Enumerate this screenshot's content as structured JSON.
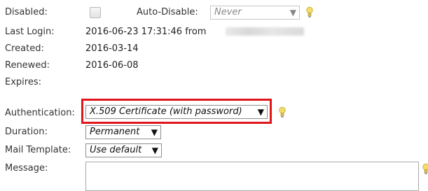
{
  "fields": {
    "disabled_label": "Disabled:",
    "auto_disable_label": "Auto-Disable:",
    "auto_disable_value": "Never",
    "last_login_label": "Last Login:",
    "last_login_value": "2016-06-23 17:31:46 from",
    "last_login_ip_hidden": "201.2016-06-08",
    "created_label": "Created:",
    "created_value": "2016-03-14",
    "renewed_label": "Renewed:",
    "renewed_value": "2016-06-08",
    "expires_label": "Expires:",
    "authentication_label": "Authentication:",
    "authentication_value": "X.509 Certificate (with password)",
    "duration_label": "Duration:",
    "duration_value": "Permanent",
    "mail_template_label": "Mail Template:",
    "mail_template_value": "Use default",
    "message_label": "Message:"
  },
  "icons": {
    "dropdown_arrow": "▼",
    "hint": "lightbulb-icon"
  },
  "colors": {
    "highlight_border": "#e0161b",
    "bulb": "#f2dc6a"
  }
}
